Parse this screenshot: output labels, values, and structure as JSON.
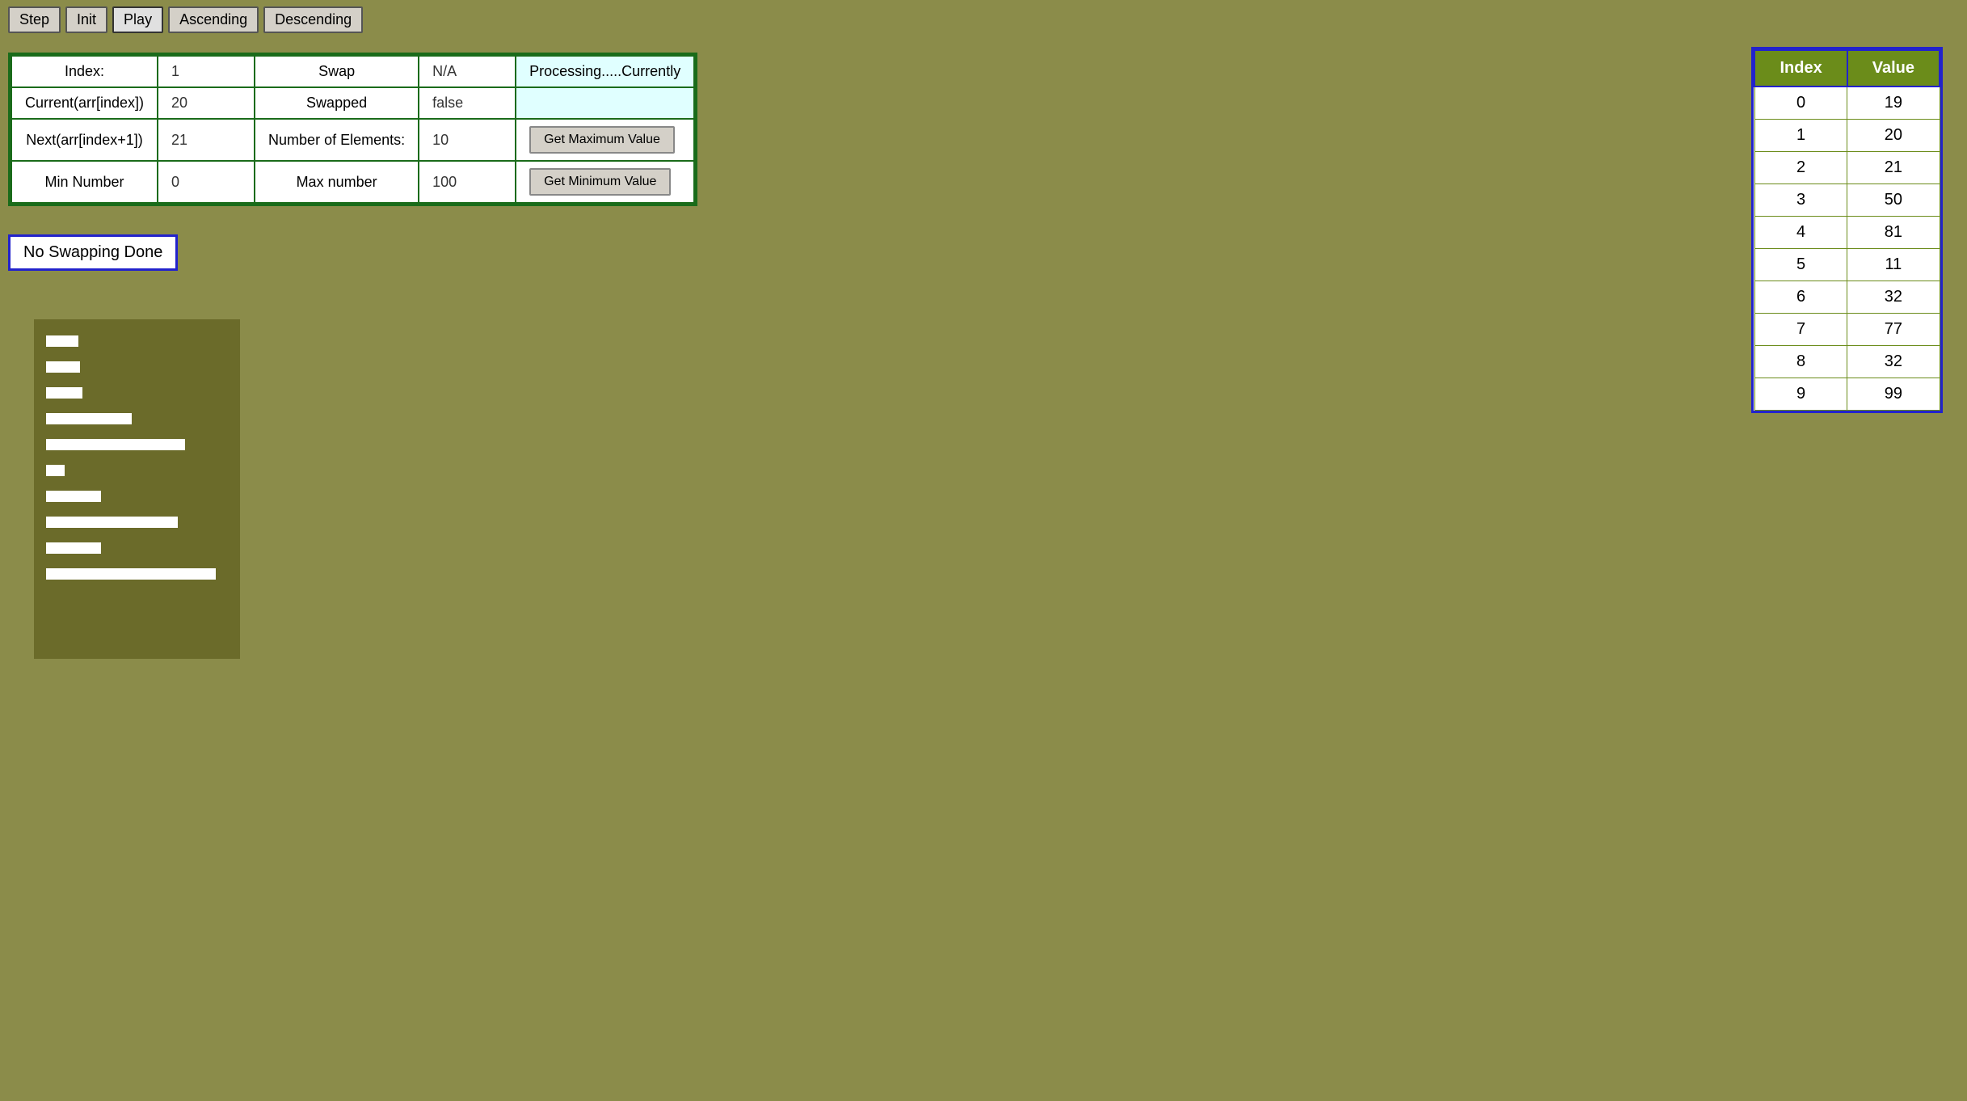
{
  "toolbar": {
    "buttons": [
      {
        "id": "step-btn",
        "label": "Step"
      },
      {
        "id": "init-btn",
        "label": "Init"
      },
      {
        "id": "play-btn",
        "label": "Play"
      },
      {
        "id": "ascending-btn",
        "label": "Ascending"
      },
      {
        "id": "descending-btn",
        "label": "Descending"
      }
    ]
  },
  "info_table": {
    "rows": [
      {
        "col1_label": "Index:",
        "col1_value": "1",
        "col2_label": "Swap",
        "col2_value": "N/A",
        "col3_label": "Processing.....Currently",
        "col3_value": ""
      },
      {
        "col1_label": "Current(arr[index])",
        "col1_value": "20",
        "col2_label": "Swapped",
        "col2_value": "false",
        "col3_label": "",
        "col3_value": ""
      },
      {
        "col1_label": "Next(arr[index+1])",
        "col1_value": "21",
        "col2_label": "Number of Elements:",
        "col2_value": "10",
        "col3_btn": "Get Maximum Value"
      },
      {
        "col1_label": "Min Number",
        "col1_value": "0",
        "col2_label": "Max number",
        "col2_value": "100",
        "col3_btn": "Get Minimum Value"
      }
    ]
  },
  "no_swap_label": "No Swapping Done",
  "right_table": {
    "headers": [
      "Index",
      "Value"
    ],
    "rows": [
      {
        "index": "0",
        "value": "19"
      },
      {
        "index": "1",
        "value": "20"
      },
      {
        "index": "2",
        "value": "21"
      },
      {
        "index": "3",
        "value": "50"
      },
      {
        "index": "4",
        "value": "81"
      },
      {
        "index": "5",
        "value": "11"
      },
      {
        "index": "6",
        "value": "32"
      },
      {
        "index": "7",
        "value": "77"
      },
      {
        "index": "8",
        "value": "32"
      },
      {
        "index": "9",
        "value": "99"
      }
    ]
  },
  "bar_chart": {
    "values": [
      19,
      20,
      21,
      50,
      81,
      11,
      32,
      77,
      32,
      99
    ],
    "max": 99,
    "bar_max_width": 210
  },
  "colors": {
    "accent_green": "#1a6b1a",
    "accent_blue": "#2222cc",
    "background": "#8b8c4a",
    "header_green": "#6b8c1a"
  }
}
